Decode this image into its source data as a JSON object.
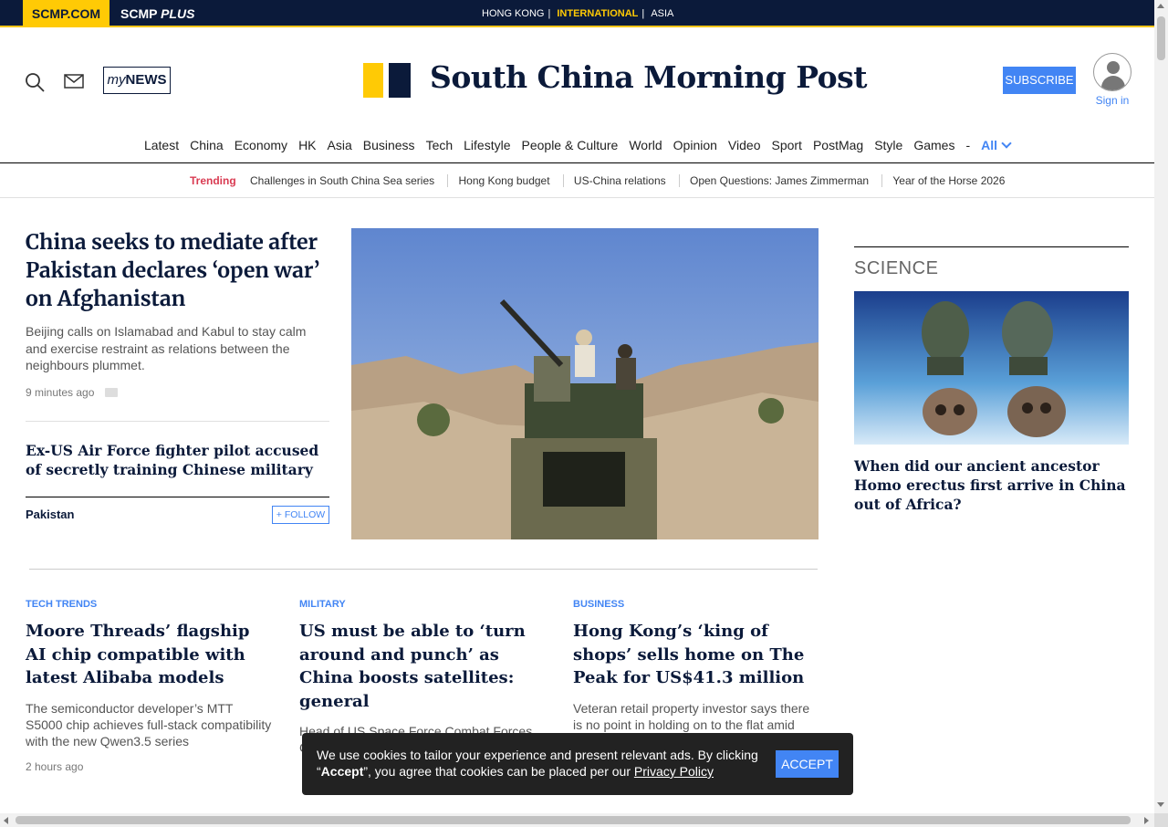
{
  "topbar": {
    "brand": "SCMP.COM",
    "plus_prefix": "SCMP ",
    "plus_suffix": "PLUS",
    "editions": [
      "HONG KONG",
      "INTERNATIONAL",
      "ASIA"
    ],
    "separator": "|"
  },
  "header": {
    "mynews_prefix": "my",
    "mynews_suffix": "NEWS",
    "logo_name": "South China Morning Post",
    "subscribe_label": "SUBSCRIBE",
    "signin_label": "Sign in"
  },
  "nav": {
    "items": [
      "Latest",
      "China",
      "Economy",
      "HK",
      "Asia",
      "Business",
      "Tech",
      "Lifestyle",
      "People & Culture",
      "World",
      "Opinion",
      "Video",
      "Sport",
      "PostMag",
      "Style",
      "Games",
      "-",
      "All"
    ]
  },
  "trending": {
    "label": "Trending",
    "items": [
      "Challenges in South China Sea series",
      "Hong Kong budget",
      "US-China relations",
      "Open Questions: James Zimmerman",
      "Year of the Horse 2026"
    ]
  },
  "lead": {
    "title": "China seeks to mediate after Pakistan declares ‘open war’ on Afghanistan",
    "summary": "Beijing calls on Islamabad and Kabul to stay calm and exercise restraint as relations between the neighbours plummet.",
    "time": "9 minutes ago",
    "related_title": "Ex-US Air Force fighter pilot accused of secretly training Chinese military",
    "topic": "Pakistan",
    "follow_label": "FOLLOW"
  },
  "sidebar": {
    "section": "SCIENCE",
    "title": "When did our ancient ancestor Homo erectus first arrive in China out of Africa?"
  },
  "cards": [
    {
      "category": "TECH TRENDS",
      "title": "Moore Threads’ flagship AI chip compatible with latest Alibaba models",
      "summary": "The semiconductor developer’s MTT S5000 chip achieves full-stack compatibility with the new Qwen3.5 series",
      "time": "2 hours ago"
    },
    {
      "category": "MILITARY",
      "title": "US must be able to ‘turn around and punch’ as China boosts satellites: general",
      "summary": "Head of US Space Force Combat Forces Command also highlights spaceplanes as",
      "time": ""
    },
    {
      "category": "BUSINESS",
      "title": "Hong Kong’s ‘king of shops’ sells home on The Peak for US$41.3 million",
      "summary": "Veteran retail property investor says there is no point in holding on to the flat amid",
      "time": ""
    }
  ],
  "cookie": {
    "text_before": "We use cookies to tailor your experience and present relevant ads. By clicking “",
    "accept_word": "Accept",
    "text_after": "”, you agree that cookies can be placed per our ",
    "policy_link": "Privacy Policy",
    "accept_label": "ACCEPT"
  },
  "colors": {
    "navy": "#0b1a3a",
    "yellow": "#ffca05",
    "blue": "#4285f4",
    "trending_red": "#d93b52"
  }
}
